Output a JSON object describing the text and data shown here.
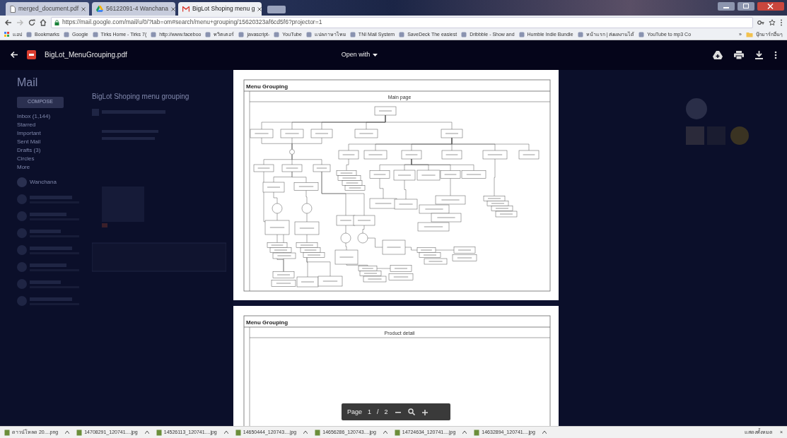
{
  "browser": {
    "tabs": [
      {
        "title": "merged_document.pdf",
        "kind": "doc",
        "selected": false
      },
      {
        "title": "56122091-4 Wanchana",
        "kind": "drive",
        "selected": false
      },
      {
        "title": "BigLot Shoping menu g",
        "kind": "mail",
        "selected": true
      }
    ],
    "url": "https://mail.google.com/mail/u/0/?tab=om#search/menu+grouping/15620323af6cd5f6?projector=1",
    "bookmarks": [
      "แอป",
      "Bookmarks",
      "Google",
      "Tirks Home - Tirks 7(",
      "http://www.faceboo",
      "ทวิตเตอร์",
      "javascript-",
      "YouTube",
      "แปลภาษาไทย",
      "TNI Mail System",
      "SaveDeck The easiest",
      "Dribbble - Show and",
      "Humble Indie Bundle",
      "หน้าแรก | ส่งผลงานได้",
      "YouTube to mp3 Co"
    ],
    "more_bookmarks": "»",
    "other_bookmarks": "บุ๊กมาร์กอื่นๆ"
  },
  "viewer": {
    "file_name": "BigLot_MenuGrouping.pdf",
    "open_with": "Open with"
  },
  "mail": {
    "title": "Mail",
    "compose": "COMPOSE",
    "folders": [
      "Inbox (1,144)",
      "Starred",
      "Important",
      "Sent Mail",
      "Drafts (3)",
      "Circles",
      "More"
    ],
    "contact": "Wanchana",
    "subject": "BigLot Shoping menu grouping"
  },
  "pages": [
    {
      "title": "Menu Grouping",
      "lane": "Main page"
    },
    {
      "title": "Menu Grouping",
      "lane": "Product detail"
    }
  ],
  "page_controls": {
    "label": "Page",
    "current": "1",
    "separator": "/",
    "total": "2"
  },
  "downloads": {
    "items": [
      "ดาวน์โหลด 20....png",
      "14708291_120741....jpg",
      "14526113_120741....jpg",
      "14650444_120743....jpg",
      "14656286_120743....jpg",
      "14724634_120741....jpg",
      "14632894_120741....jpg"
    ],
    "show_all": "แสดงทั้งหมด",
    "close": "×"
  }
}
